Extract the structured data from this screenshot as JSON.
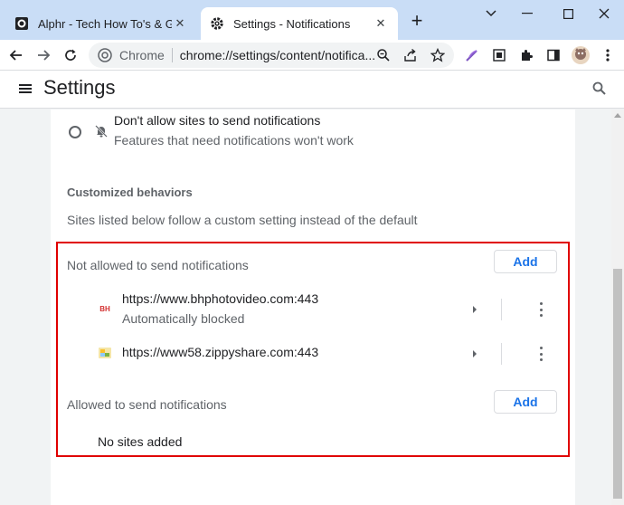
{
  "browser": {
    "tabs": [
      {
        "title": "Alphr - Tech How To's & Guides",
        "active": false
      },
      {
        "title": "Settings - Notifications",
        "active": true
      }
    ],
    "omnibox": {
      "chip": "Chrome",
      "url": "chrome://settings/content/notifica..."
    }
  },
  "settings": {
    "title": "Settings",
    "option": {
      "label": "Don't allow sites to send notifications",
      "sublabel": "Features that need notifications won't work"
    },
    "customized": {
      "title": "Customized behaviors",
      "description": "Sites listed below follow a custom setting instead of the default"
    },
    "blocked": {
      "heading": "Not allowed to send notifications",
      "add_label": "Add",
      "sites": [
        {
          "url": "https://www.bhphotovideo.com:443",
          "sub": "Automatically blocked"
        },
        {
          "url": "https://www58.zippyshare.com:443",
          "sub": ""
        }
      ]
    },
    "allowed": {
      "heading": "Allowed to send notifications",
      "add_label": "Add",
      "empty": "No sites added"
    }
  },
  "colors": {
    "accent": "#1a73e8",
    "highlight_border": "#e00000"
  }
}
